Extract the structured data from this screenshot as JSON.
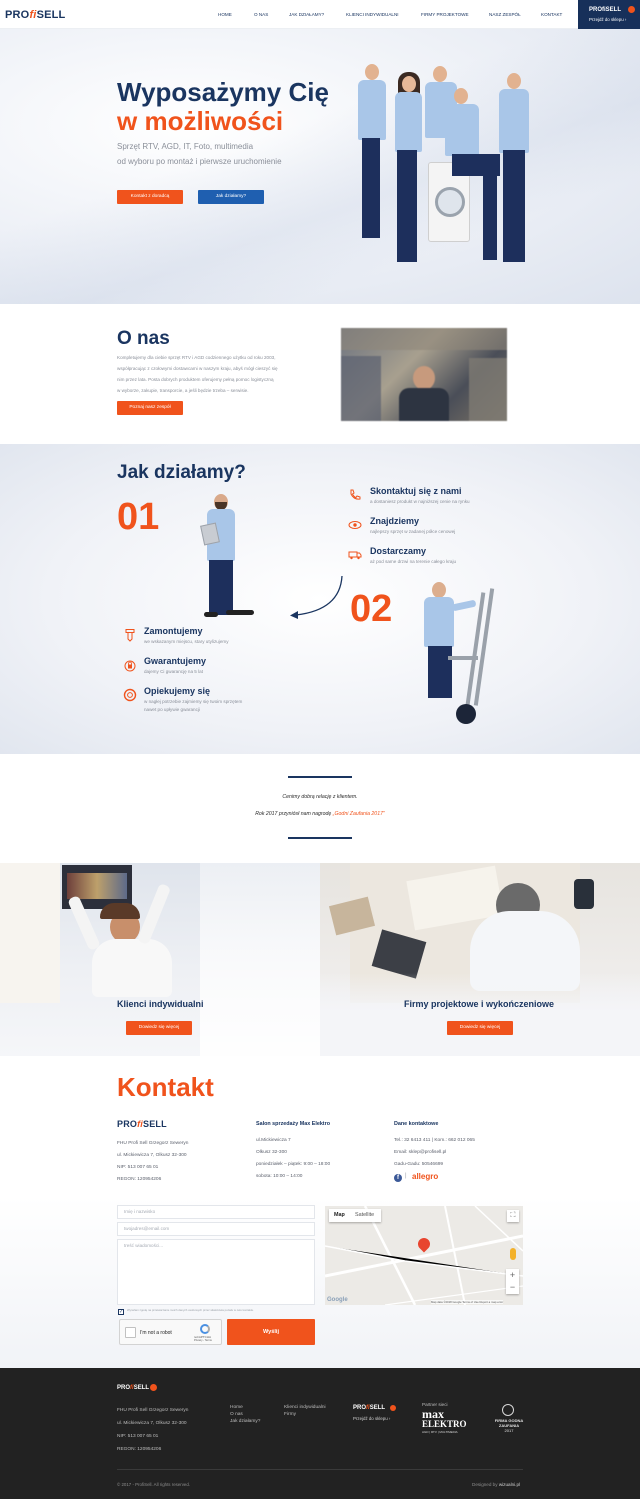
{
  "header": {
    "logo": {
      "pre": "PRO",
      "mid": "fi",
      "post": "SELL"
    },
    "nav": [
      "HOME",
      "O NAS",
      "JAK DZIAŁAMY?",
      "KLIENCI INDYWIDUALNI",
      "FIRMY PROJEKTOWE",
      "NASZ ZESPÓŁ",
      "KONTAKT"
    ],
    "shop": {
      "logo_text": "PROfiSELL",
      "link": "Przejdź do sklepu"
    }
  },
  "hero": {
    "title_1": "Wyposażymy Cię",
    "title_2": "w możliwości",
    "sub_1": "Sprzęt RTV, AGD, IT, Foto, multimedia",
    "sub_2": "od wyboru po montaż i pierwsze uruchomienie",
    "btn_consult": "Kontakt z doradcą",
    "btn_how": "Jak działamy?"
  },
  "about": {
    "title": "O nas",
    "text_1": "Kompletujemy dla ciebie sprzęt RTV i AGD codziennego użytku od roku 2003,",
    "text_2": "współpracując z czołowymi dostawcami w naszym kraju, abyś mógł cieszyć się",
    "text_3": "nim przez lata. Posta dobrych produktem oferujemy pełną pomoc logistyczną",
    "text_4": "w wyborze, zakupie, transporcie, a jeśli będzie trzeba – serwisie.",
    "btn": "Poznaj nasz zespół"
  },
  "how": {
    "title": "Jak działamy?",
    "num_1": "01",
    "num_2": "02",
    "steps_right": [
      {
        "title": "Skontaktuj się z nami",
        "desc": "a dostaniesz produkt w najniższej cenie na rynku",
        "icon": "phone-icon"
      },
      {
        "title": "Znajdziemy",
        "desc": "najlepszy sprzęt w zadanej półce cenowej",
        "icon": "eye-icon"
      },
      {
        "title": "Dostarczamy",
        "desc": "aż pod same drzwi na terenie całego kraju",
        "icon": "truck-icon"
      }
    ],
    "steps_left": [
      {
        "title": "Zamontujemy",
        "desc": "we wskazanym miejscu, stary utylizujemy",
        "icon": "screw-icon"
      },
      {
        "title": "Gwarantujemy",
        "desc": "dajemy Ci gwarancję na 5 lat",
        "icon": "lock-icon"
      },
      {
        "title": "Opiekujemy się",
        "desc": "w nagłej potrzebie zajmiemy się twoim sprzętem",
        "desc2": "nawet po upływie gwarancji",
        "icon": "lifebuoy-icon"
      }
    ]
  },
  "quote": {
    "line_1": "Cenimy dobrą relację z klientem.",
    "line_2_pre": "Rok 2017 przyniósł nam nagrodę",
    "line_2_award": "„Godni Zaufania 2017\""
  },
  "clients": {
    "individual": {
      "label": "Klienci indywidualni",
      "btn": "Dowiedz się więcej"
    },
    "companies": {
      "label": "Firmy projektowe i wykończeniowe",
      "btn": "Dowiedz się więcej"
    }
  },
  "contact": {
    "title": "Kontakt",
    "company": [
      "FHU Profi Sell Grzegorz Seweryn",
      "ul. Mickiewicza 7, Olkusz 32-300",
      "NIP: 513 007 65 01",
      "REGON: 120954206"
    ],
    "salon_head": "Salon sprzedaży Max Elektro",
    "salon": [
      "ul.Mickiewicza 7",
      "Olkusz 32-300",
      "poniedziałek – piątek: 9:00 – 18:00",
      "sobota: 10:00 – 14:00"
    ],
    "data_head": "Dane kontaktowe",
    "data": [
      "Tel.: 32 6413 411 | Kom.: 662 012 065",
      "Email: sklep@profisell.pl",
      "Gadu-Gadu: 50546699"
    ],
    "allegro": "allegro",
    "form": {
      "name_ph": "Imię i nazwisko",
      "email_ph": "twojadres@email.com",
      "msg_ph": "treść wiadomości...",
      "consent": "Wyrażam zgodę na przetwarzanie moich danych osobowych przez właściciela portalu w celu kontaktu.",
      "captcha": "I'm not a robot",
      "captcha_brand": "reCAPTCHA",
      "captcha_terms": "Privacy - Terms",
      "submit": "Wyślij"
    },
    "map": {
      "tab_map": "Map",
      "tab_sat": "Satellite",
      "attribution": "Map data ©2018 Google   Terms of Use   Report a map error"
    }
  },
  "footer": {
    "company": [
      "FHU Profi Sell Grzegorz Seweryn",
      "ul. Mickiewicza 7, Olkusz 32-300",
      "NIP: 513 007 65 01",
      "REGON: 120954206"
    ],
    "links_1": [
      "Home",
      "O nas",
      "Jak działamy?"
    ],
    "links_2": [
      "Klienci indywidualni",
      "Firmy"
    ],
    "shop_link": "Przejdź do sklepu",
    "partner": "Partner sieci",
    "max": "max",
    "elektro": "ELEKTRO",
    "max_sub": "AGD | RTV | MULTIMEDIA",
    "award_1": "FIRMA GODNA",
    "award_2": "ZAUFANIA",
    "award_3": "2017",
    "copyright": "© 2017 - ProfiSell. All rights reserved.",
    "designed_pre": "Designed by",
    "designed": "wizualni.pl"
  },
  "colors": {
    "navy": "#1a3560",
    "orange": "#f0531c",
    "blue_btn": "#1f5fb0",
    "footer": "#222222"
  }
}
